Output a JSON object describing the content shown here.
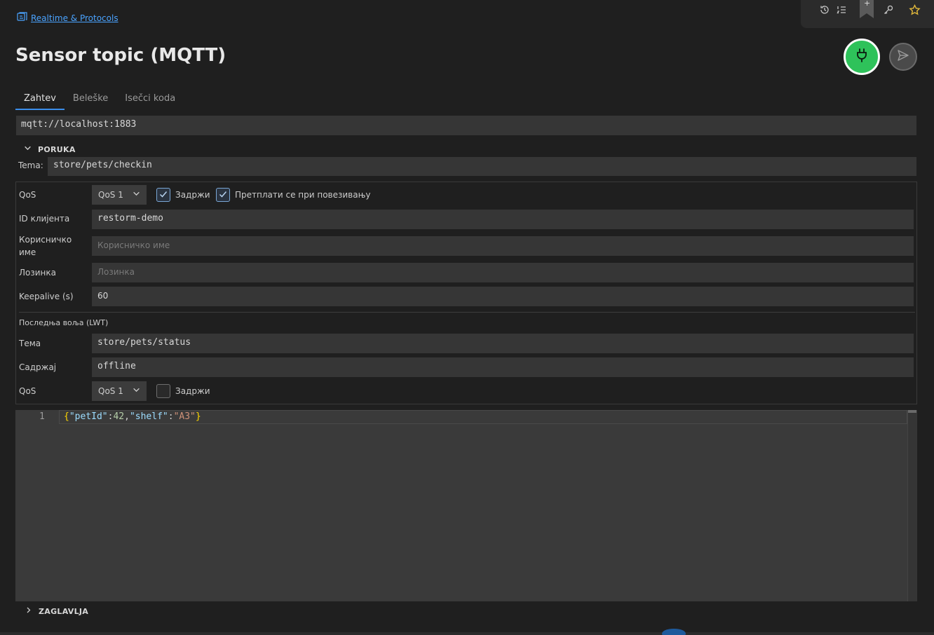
{
  "breadcrumb": {
    "icon": "collection-icon",
    "label": "Realtime & Protocols"
  },
  "title": "Sensor topic (MQTT)",
  "toolbar": {
    "icons": [
      "history-icon",
      "list-numbered-icon",
      "bookmark-add-icon",
      "key-icon",
      "star-icon"
    ],
    "bookmark_plus": "+",
    "star_color": "#e2b93b"
  },
  "actions": {
    "connect_icon": "plug-icon",
    "connect_color": "#2ec25a",
    "send_icon": "send-icon"
  },
  "tabs": [
    {
      "label": "Zahtev",
      "active": true
    },
    {
      "label": "Beleške",
      "active": false
    },
    {
      "label": "Isečci koda",
      "active": false
    }
  ],
  "url": "mqtt://localhost:1883",
  "message_section": {
    "title": "PORUKA",
    "topic_label": "Tema:",
    "topic_value": "store/pets/checkin"
  },
  "connection": {
    "qos_label": "QoS",
    "qos_value": "QoS 1",
    "retain_label": "Задржи",
    "retain_checked": true,
    "subscribe_label": "Претплати се при повезивању",
    "subscribe_checked": true,
    "client_id_label": "ID клијента",
    "client_id_value": "restorm-demo",
    "username_label_line1": "Корисничко",
    "username_label_line2": "име",
    "username_placeholder": "Корисничко име",
    "password_label": "Лозинка",
    "password_placeholder": "Лозинка",
    "keepalive_label": "Keepalive (s)",
    "keepalive_value": "60"
  },
  "lwt": {
    "title": "Последња воља (LWT)",
    "topic_label": "Тема",
    "topic_value": "store/pets/status",
    "payload_label": "Садржај",
    "payload_value": "offline",
    "qos_label": "QoS",
    "qos_value": "QoS 1",
    "retain_label": "Задржи",
    "retain_checked": false
  },
  "editor": {
    "line_number": "1",
    "tokens": {
      "open_brace": "{",
      "key1": "\"petId\"",
      "colon1": ":",
      "num1": "42",
      "comma": ",",
      "key2": "\"shelf\"",
      "colon2": ":",
      "str2": "\"A3\"",
      "close_brace": "}"
    }
  },
  "headers_section": {
    "title": "ZAGLAVLJA"
  }
}
